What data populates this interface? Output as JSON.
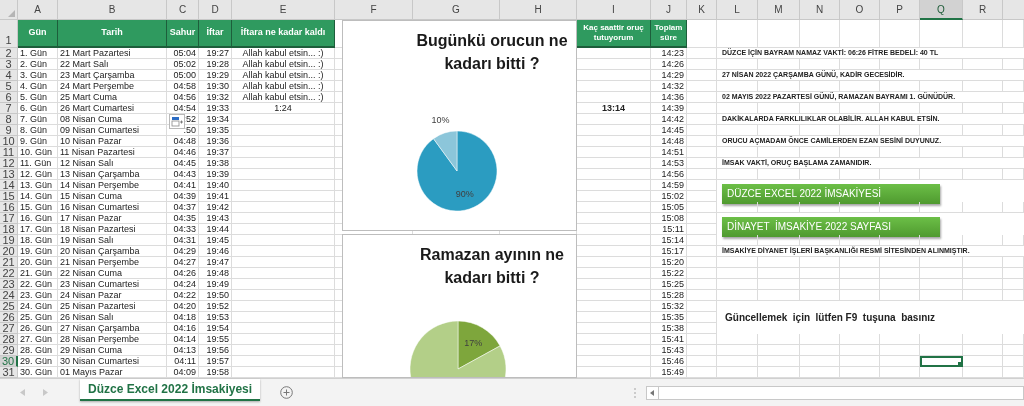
{
  "columns": [
    {
      "label": "A",
      "selected": false
    },
    {
      "label": "B",
      "selected": false
    },
    {
      "label": "C",
      "selected": false
    },
    {
      "label": "D",
      "selected": false
    },
    {
      "label": "E",
      "selected": false
    },
    {
      "label": "F",
      "selected": false
    },
    {
      "label": "G",
      "selected": false
    },
    {
      "label": "H",
      "selected": false
    },
    {
      "label": "I",
      "selected": false
    },
    {
      "label": "J",
      "selected": false
    },
    {
      "label": "K",
      "selected": false
    },
    {
      "label": "L",
      "selected": false
    },
    {
      "label": "M",
      "selected": false
    },
    {
      "label": "N",
      "selected": false
    },
    {
      "label": "O",
      "selected": false
    },
    {
      "label": "P",
      "selected": false
    },
    {
      "label": "Q",
      "selected": true
    },
    {
      "label": "R",
      "selected": false
    }
  ],
  "header_row": {
    "number": "1",
    "gun": "Gün",
    "tarih": "Tarih",
    "sahur": "Sahur",
    "iftar": "İftar",
    "kalan": "İftara ne kadar kaldı",
    "kac": "Kaç saattir oruç tutuyorum",
    "toplam": "Toplam süre"
  },
  "rows": [
    {
      "number": "2",
      "gun": "1. Gün",
      "tarih": "21 Mart Pazartesi",
      "sahur": "05:04",
      "iftar": "19:27",
      "kalan": "Allah kabul etsin... :)",
      "toplam": "14:23",
      "note": "DÜZCE İÇİN BAYRAM NAMAZ VAKTİ: 06:26 FİTRE BEDELİ: 40 TL",
      "selected": false
    },
    {
      "number": "3",
      "gun": "2. Gün",
      "tarih": "22 Mart Salı",
      "sahur": "05:02",
      "iftar": "19:28",
      "kalan": "Allah kabul etsin... :)",
      "toplam": "14:26",
      "selected": false
    },
    {
      "number": "4",
      "gun": "3. Gün",
      "tarih": "23 Mart Çarşamba",
      "sahur": "05:00",
      "iftar": "19:29",
      "kalan": "Allah kabul etsin... :)",
      "toplam": "14:29",
      "note": "27 NİSAN 2022 ÇARŞAMBA GÜNÜ, KADİR GECESİDİR.",
      "selected": false
    },
    {
      "number": "5",
      "gun": "4. Gün",
      "tarih": "24 Mart Perşembe",
      "sahur": "04:58",
      "iftar": "19:30",
      "kalan": "Allah kabul etsin... :)",
      "toplam": "14:32",
      "selected": false
    },
    {
      "number": "6",
      "gun": "5. Gün",
      "tarih": "25 Mart Cuma",
      "sahur": "04:56",
      "iftar": "19:32",
      "kalan": "Allah kabul etsin... :)",
      "toplam": "14:36",
      "note": "02 MAYIS 2022 PAZARTESİ GÜNÜ, RAMAZAN BAYRAMI 1. GÜNÜDÜR.",
      "selected": false
    },
    {
      "number": "7",
      "gun": "6. Gün",
      "tarih": "26 Mart Cumartesi",
      "sahur": "04:54",
      "iftar": "19:33",
      "kalan": "1:24",
      "kac": "13:14",
      "toplam": "14:39",
      "selected": false
    },
    {
      "number": "8",
      "gun": "7. Gün",
      "tarih": "08 Nisan Cuma",
      "sahur": ":52",
      "iftar": "19:34",
      "toplam": "14:42",
      "note": "DAKİKALARDA FARKLILIKLAR OLABİLİR. ALLAH KABUL ETSİN.",
      "selected": false
    },
    {
      "number": "9",
      "gun": "8. Gün",
      "tarih": "09 Nisan Cumartesi",
      "sahur": ":50",
      "iftar": "19:35",
      "toplam": "14:45",
      "selected": false
    },
    {
      "number": "10",
      "gun": "9. Gün",
      "tarih": "10 Nisan Pazar",
      "sahur": "04:48",
      "iftar": "19:36",
      "toplam": "14:48",
      "note": "ORUCU AÇMADAM ÖNCE CAMİLERDEN EZAN SESİNİ DUYUNUZ.",
      "selected": false
    },
    {
      "number": "11",
      "gun": "10. Gün",
      "tarih": "11 Nisan Pazartesi",
      "sahur": "04:46",
      "iftar": "19:37",
      "toplam": "14:51",
      "selected": false
    },
    {
      "number": "12",
      "gun": "11. Gün",
      "tarih": "12 Nisan Salı",
      "sahur": "04:45",
      "iftar": "19:38",
      "toplam": "14:53",
      "note": "İMSAK VAKTİ, ORUÇ BAŞLAMA ZAMANIDIR.",
      "selected": false
    },
    {
      "number": "13",
      "gun": "12. Gün",
      "tarih": "13 Nisan Çarşamba",
      "sahur": "04:43",
      "iftar": "19:39",
      "toplam": "14:56",
      "selected": false
    },
    {
      "number": "14",
      "gun": "13. Gün",
      "tarih": "14 Nisan Perşembe",
      "sahur": "04:41",
      "iftar": "19:40",
      "toplam": "14:59",
      "selected": false
    },
    {
      "number": "15",
      "gun": "14. Gün",
      "tarih": "15 Nisan Cuma",
      "sahur": "04:39",
      "iftar": "19:41",
      "toplam": "15:02",
      "selected": false
    },
    {
      "number": "16",
      "gun": "15. Gün",
      "tarih": "16 Nisan Cumartesi",
      "sahur": "04:37",
      "iftar": "19:42",
      "toplam": "15:05",
      "selected": false
    },
    {
      "number": "17",
      "gun": "16. Gün",
      "tarih": "17 Nisan Pazar",
      "sahur": "04:35",
      "iftar": "19:43",
      "toplam": "15:08",
      "selected": false
    },
    {
      "number": "18",
      "gun": "17. Gün",
      "tarih": "18 Nisan Pazartesi",
      "sahur": "04:33",
      "iftar": "19:44",
      "toplam": "15:11",
      "selected": false
    },
    {
      "number": "19",
      "gun": "18. Gün",
      "tarih": "19 Nisan Salı",
      "sahur": "04:31",
      "iftar": "19:45",
      "toplam": "15:14",
      "selected": false
    },
    {
      "number": "20",
      "gun": "19. Gün",
      "tarih": "20 Nisan Çarşamba",
      "sahur": "04:29",
      "iftar": "19:46",
      "toplam": "15:17",
      "note": "İMSAKİYE DİYANET İŞLERİ BAŞKANLIĞI RESMİ SİTESİNDEN ALINMIŞTIR.",
      "selected": false
    },
    {
      "number": "21",
      "gun": "20. Gün",
      "tarih": "21 Nisan Perşembe",
      "sahur": "04:27",
      "iftar": "19:47",
      "toplam": "15:20",
      "selected": false
    },
    {
      "number": "22",
      "gun": "21. Gün",
      "tarih": "22 Nisan Cuma",
      "sahur": "04:26",
      "iftar": "19:48",
      "toplam": "15:22",
      "selected": false
    },
    {
      "number": "23",
      "gun": "22. Gün",
      "tarih": "23 Nisan Cumartesi",
      "sahur": "04:24",
      "iftar": "19:49",
      "toplam": "15:25",
      "selected": false
    },
    {
      "number": "24",
      "gun": "23. Gün",
      "tarih": "24 Nisan Pazar",
      "sahur": "04:22",
      "iftar": "19:50",
      "toplam": "15:28",
      "selected": false
    },
    {
      "number": "25",
      "gun": "24. Gün",
      "tarih": "25 Nisan Pazartesi",
      "sahur": "04:20",
      "iftar": "19:52",
      "toplam": "15:32",
      "selected": false
    },
    {
      "number": "26",
      "gun": "25. Gün",
      "tarih": "26 Nisan Salı",
      "sahur": "04:18",
      "iftar": "19:53",
      "toplam": "15:35",
      "selected": false
    },
    {
      "number": "27",
      "gun": "26. Gün",
      "tarih": "27 Nisan Çarşamba",
      "sahur": "04:16",
      "iftar": "19:54",
      "toplam": "15:38",
      "selected": false
    },
    {
      "number": "28",
      "gun": "27. Gün",
      "tarih": "28 Nisan Perşembe",
      "sahur": "04:14",
      "iftar": "19:55",
      "toplam": "15:41",
      "selected": false
    },
    {
      "number": "29",
      "gun": "28. Gün",
      "tarih": "29 Nisan Cuma",
      "sahur": "04:13",
      "iftar": "19:56",
      "toplam": "15:43",
      "selected": false
    },
    {
      "number": "30",
      "gun": "29. Gün",
      "tarih": "30 Nisan Cumartesi",
      "sahur": "04:11",
      "iftar": "19:57",
      "toplam": "15:46",
      "selected": true
    },
    {
      "number": "31",
      "gun": "30. Gün",
      "tarih": "01 Mayıs Pazar",
      "sahur": "04:09",
      "iftar": "19:58",
      "toplam": "15:49",
      "selected": false
    }
  ],
  "charts": [
    {
      "chart_data": {
        "type": "pie",
        "title": "Bugünkü orucun ne kadarı bitti ?",
        "values": [
          90,
          10
        ],
        "colors": [
          "#2b9cc1",
          "#8cc6da"
        ],
        "value_labels": [
          "90%",
          "10%"
        ]
      }
    },
    {
      "chart_data": {
        "type": "pie",
        "title": "Ramazan ayının ne kadarı bitti ?",
        "values": [
          17,
          83
        ],
        "colors": [
          "#7ea63c",
          "#b3cf88"
        ],
        "value_labels": [
          "17%",
          null
        ]
      }
    }
  ],
  "buttons": [
    "DÜZCE EXCEL 2022 İMSAKİYESİ",
    "DİNAYET  İMSAKİYE 2022 SAYFASI"
  ],
  "text_box": "Güncellemek  için  lütfen F9  tuşuna  basınız",
  "sheet_tabs": [
    {
      "label": "Düzce Excel 2022 İmsakiyesi",
      "selected": true
    }
  ]
}
